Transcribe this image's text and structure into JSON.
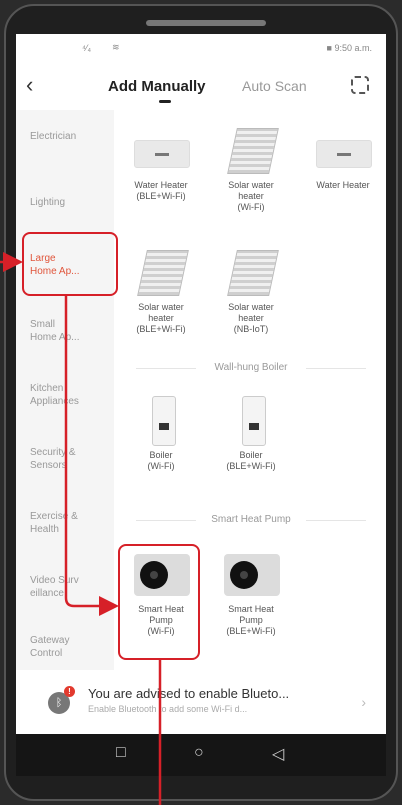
{
  "status": {
    "signal": "⁴⁄₄",
    "wifi": "≋",
    "time": "■ 9:50 a.m."
  },
  "header": {
    "back": "‹",
    "tab_add": "Add Manually",
    "tab_auto": "Auto Scan"
  },
  "sidebar": {
    "items": [
      {
        "label": "Electrician"
      },
      {
        "label": "Lighting"
      },
      {
        "label": "Large\nHome Ap..."
      },
      {
        "label": "Small\nHome Ap..."
      },
      {
        "label": "Kitchen\nAppliances"
      },
      {
        "label": "Security &\nSensors"
      },
      {
        "label": "Exercise &\nHealth"
      },
      {
        "label": "Video Surv\neillance"
      },
      {
        "label": "Gateway\nControl"
      }
    ]
  },
  "products": {
    "water_heater_ble": "Water Heater\n(BLE+Wi-Fi)",
    "solar_wifi": "Solar water\nheater\n(Wi-Fi)",
    "water_heater": "Water Heater",
    "solar_ble": "Solar water\nheater\n(BLE+Wi-Fi)",
    "solar_nbiot": "Solar water\nheater\n(NB-IoT)",
    "section_boiler": "Wall-hung Boiler",
    "boiler_wifi": "Boiler\n(Wi-Fi)",
    "boiler_ble": "Boiler\n(BLE+Wi-Fi)",
    "section_pump": "Smart Heat Pump",
    "pump_wifi": "Smart Heat\nPump\n(Wi-Fi)",
    "pump_ble": "Smart Heat\nPump\n(BLE+Wi-Fi)"
  },
  "banner": {
    "title": "You are advised to enable Blueto...",
    "subtitle": "Enable Bluetooth to add some Wi-Fi d...",
    "badge": "!",
    "arrow": "›"
  },
  "navbar": {
    "back": "◁",
    "home": "○",
    "recent": "□"
  },
  "colors": {
    "accent": "#d62028"
  }
}
